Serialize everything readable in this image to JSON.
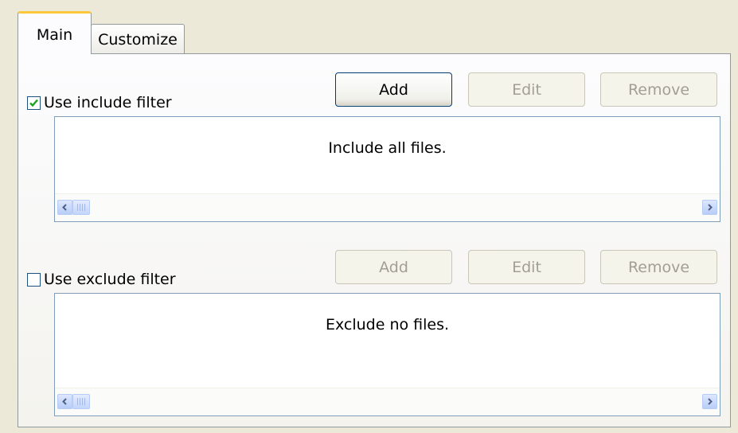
{
  "tabs": [
    {
      "label": "Main",
      "active": true
    },
    {
      "label": "Customize",
      "active": false
    }
  ],
  "include": {
    "checkbox_label": "Use include filter",
    "checked": true,
    "buttons": {
      "add": "Add",
      "edit": "Edit",
      "remove": "Remove"
    },
    "list_text": "Include all files."
  },
  "exclude": {
    "checkbox_label": "Use exclude filter",
    "checked": false,
    "buttons": {
      "add": "Add",
      "edit": "Edit",
      "remove": "Remove"
    },
    "list_text": "Exclude no files."
  },
  "icons": {
    "checkmark": "checkmark-icon",
    "scroll_left": "chevron-left-icon",
    "scroll_right": "chevron-right-icon",
    "scroll_thumb": "scrollbar-grip-icon"
  },
  "colors": {
    "background": "#ece9d8",
    "tab_highlight": "#ffc83c",
    "checkmark": "#21a121",
    "scroll_arrow": "#4d6185",
    "disabled_text": "#a19f93",
    "default_button_border": "#003c74"
  }
}
